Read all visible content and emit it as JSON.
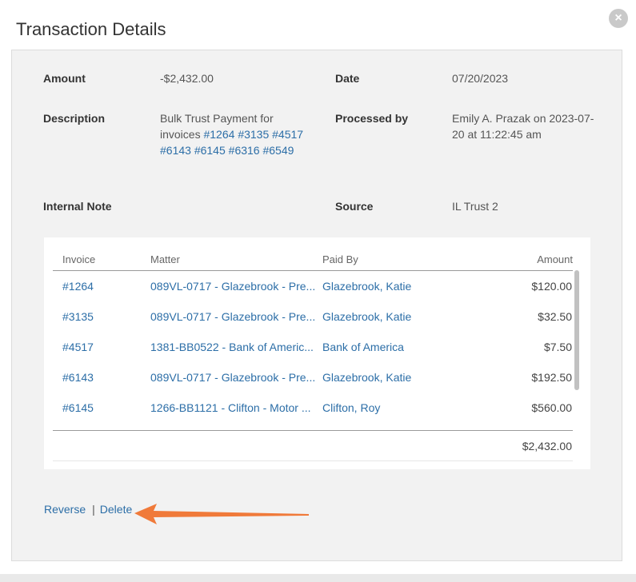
{
  "dialog": {
    "title": "Transaction Details",
    "close_icon": "close-icon"
  },
  "details": {
    "amount_label": "Amount",
    "amount_value": "-$2,432.00",
    "date_label": "Date",
    "date_value": "07/20/2023",
    "description_label": "Description",
    "description_prefix": "Bulk Trust Payment for invoices",
    "description_links": [
      "#1264",
      "#3135",
      "#4517",
      "#6143",
      "#6145",
      "#6316",
      "#6549"
    ],
    "processed_label": "Processed by",
    "processed_line1": "Emily A. Prazak on 2023-07-",
    "processed_line2": "20 at 11:22:45 am",
    "note_label": "Internal Note",
    "source_label": "Source",
    "source_value": "IL Trust 2"
  },
  "table": {
    "headers": [
      "Invoice",
      "Matter",
      "Paid By",
      "Amount"
    ],
    "rows": [
      {
        "invoice": "#1264",
        "matter": "089VL-0717 - Glazebrook - Pre...",
        "paid_by": "Glazebrook, Katie",
        "amount": "$120.00"
      },
      {
        "invoice": "#3135",
        "matter": "089VL-0717 - Glazebrook - Pre...",
        "paid_by": "Glazebrook, Katie",
        "amount": "$32.50"
      },
      {
        "invoice": "#4517",
        "matter": "1381-BB0522 - Bank of Americ...",
        "paid_by": "Bank of America",
        "amount": "$7.50"
      },
      {
        "invoice": "#6143",
        "matter": "089VL-0717 - Glazebrook - Pre...",
        "paid_by": "Glazebrook, Katie",
        "amount": "$192.50"
      },
      {
        "invoice": "#6145",
        "matter": "1266-BB1121 - Clifton - Motor ...",
        "paid_by": "Clifton, Roy",
        "amount": "$560.00"
      }
    ],
    "total": "$2,432.00"
  },
  "actions": {
    "reverse_label": "Reverse",
    "separator": "|",
    "delete_label": "Delete"
  },
  "colors": {
    "link": "#2c6ea7",
    "arrow": "#f07a3a"
  }
}
